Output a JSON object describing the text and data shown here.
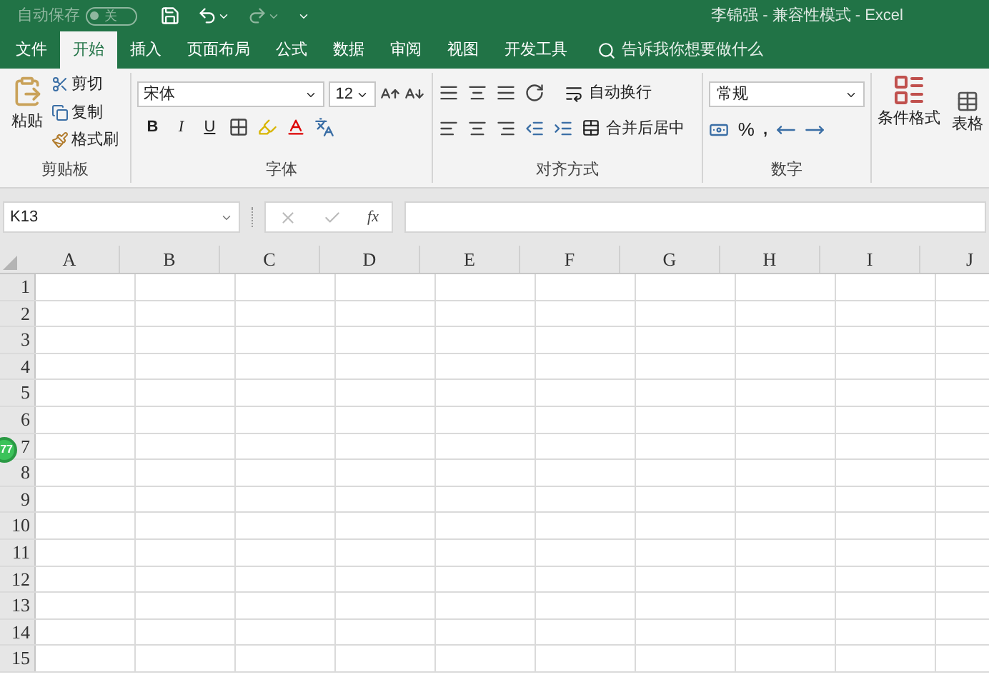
{
  "title_bar": {
    "autosave": {
      "label": "自动保存",
      "on": false,
      "state_text": "关"
    },
    "title": "李锦强 - 兼容性模式 - Excel"
  },
  "tabs": [
    {
      "label": "文件",
      "selected": false
    },
    {
      "label": "开始",
      "selected": true
    },
    {
      "label": "插入",
      "selected": false
    },
    {
      "label": "页面布局",
      "selected": false
    },
    {
      "label": "公式",
      "selected": false
    },
    {
      "label": "数据",
      "selected": false
    },
    {
      "label": "审阅",
      "selected": false
    },
    {
      "label": "视图",
      "selected": false
    },
    {
      "label": "开发工具",
      "selected": false
    }
  ],
  "tell_me": {
    "placeholder": "告诉我你想要做什么"
  },
  "ribbon": {
    "clipboard": {
      "paste": "粘贴",
      "cut": "剪切",
      "copy": "复制",
      "format_painter": "格式刷",
      "label": "剪贴板"
    },
    "font": {
      "font_name": "宋体",
      "font_size": "12",
      "bold": "B",
      "italic": "I",
      "underline": "U",
      "label": "字体"
    },
    "alignment": {
      "wrap_text": "自动换行",
      "merge_center": "合并后居中",
      "label": "对齐方式"
    },
    "number": {
      "format": "常规",
      "percent": "%",
      "comma": ",",
      "label": "数字"
    },
    "styles": {
      "conditional_formatting": "条件格式",
      "format_as_table": "表格"
    }
  },
  "formula_bar": {
    "name_box": "K13",
    "fx": "fx"
  },
  "columns": [
    "A",
    "B",
    "C",
    "D",
    "E",
    "F",
    "G",
    "H",
    "I",
    "J"
  ],
  "rows": [
    "1",
    "2",
    "3",
    "4",
    "5",
    "6",
    "7",
    "8",
    "9",
    "10",
    "11",
    "12",
    "13",
    "14",
    "15"
  ],
  "floating_badge": {
    "text": "77"
  }
}
